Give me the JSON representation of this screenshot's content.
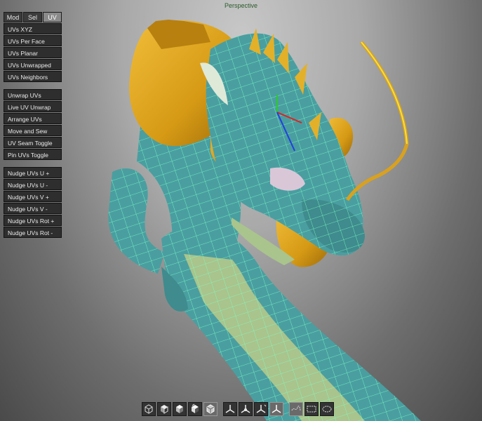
{
  "viewport": {
    "title": "Perspective"
  },
  "tabs": [
    {
      "label": "Mod",
      "active": false
    },
    {
      "label": "Sel",
      "active": false
    },
    {
      "label": "UV",
      "active": true
    }
  ],
  "uv_display": [
    "UVs XYZ",
    "UVs Per Face",
    "UVs Planar",
    "UVs Unwrapped",
    "UVs Neighbors"
  ],
  "uv_tools": [
    "Unwrap UVs",
    "Live UV Unwrap",
    "Arrange UVs",
    "Move and Sew",
    "UV Seam Toggle",
    "Pin UVs Toggle"
  ],
  "uv_nudge": [
    "Nudge UVs U +",
    "Nudge UVs U -",
    "Nudge UVs V +",
    "Nudge UVs V -",
    "Nudge UVs Rot +",
    "Nudge UVs Rot -"
  ],
  "toolbar": {
    "shading_icons": [
      "wireframe-cube-icon",
      "half-shaded-cube-icon",
      "shaded-cube-icon",
      "textured-cube-icon",
      "xray-cube-icon"
    ],
    "shading_active": 4,
    "axis_icons": [
      "axis-gizmo-icon",
      "axis-gizmo-local-icon",
      "axis-gizmo-world-icon",
      "axis-gizmo-screen-icon"
    ],
    "axis_active": 3,
    "select_icons": [
      "lasso-select-icon",
      "rect-select-icon",
      "ellipse-select-icon"
    ],
    "select_active": 0
  },
  "colors": {
    "mesh": "#4a9ea0",
    "mesh_light": "#a9c48c",
    "wire": "#7dffc6",
    "gold": "#d9a11e",
    "gold_dark": "#a4720c"
  }
}
